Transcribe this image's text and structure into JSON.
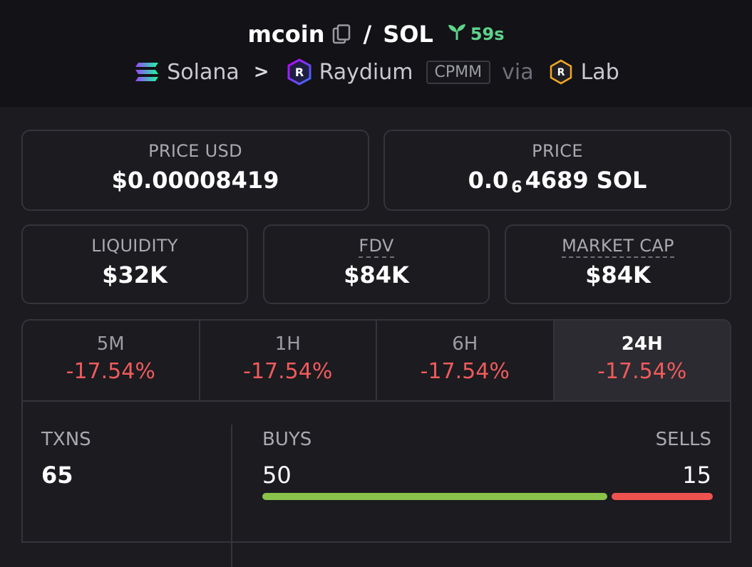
{
  "header": {
    "token": "mcoin",
    "quote": "SOL",
    "age": "59s",
    "chain": "Solana",
    "dex": "Raydium",
    "pool_type": "CPMM",
    "via": "via",
    "launchpad": "Lab"
  },
  "stats": {
    "price_usd_label": "PRICE USD",
    "price_usd": "$0.00008419",
    "price_label": "PRICE",
    "price_prefix": "0.0",
    "price_zeros": "6",
    "price_rest": "4689 SOL",
    "liquidity_label": "LIQUIDITY",
    "liquidity": "$32K",
    "fdv_label": "FDV",
    "fdv": "$84K",
    "mcap_label": "MARKET CAP",
    "mcap": "$84K"
  },
  "periods": [
    {
      "label": "5M",
      "change": "-17.54%"
    },
    {
      "label": "1H",
      "change": "-17.54%"
    },
    {
      "label": "6H",
      "change": "-17.54%"
    },
    {
      "label": "24H",
      "change": "-17.54%"
    }
  ],
  "txns": {
    "txns_label": "TXNS",
    "txns": "65",
    "buys_label": "BUYS",
    "buys": "50",
    "sells_label": "SELLS",
    "sells": "15",
    "buy_ratio": 0.77
  },
  "colors": {
    "positive": "#5fd38b",
    "negative": "#ef5b5b",
    "buy_bar": "#8bc34a",
    "sell_bar": "#ef5350"
  },
  "icons": [
    "copy-icon",
    "sprout-icon",
    "solana-icon",
    "raydium-icon",
    "lab-icon"
  ]
}
